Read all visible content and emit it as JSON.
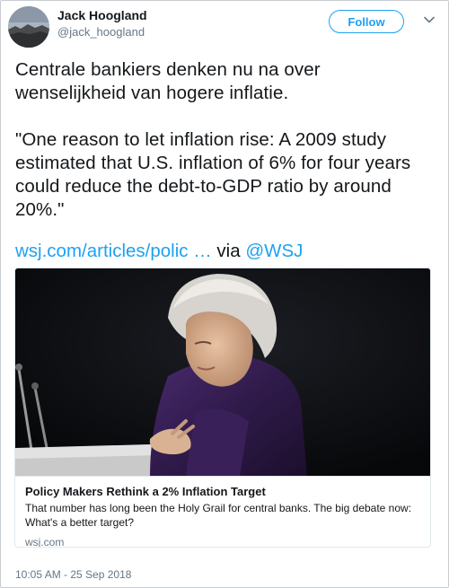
{
  "user": {
    "name": "Jack Hoogland",
    "handle": "@jack_hoogland"
  },
  "follow_label": "Follow",
  "tweet": {
    "text": "Centrale bankiers denken nu na over\nwenselijkheid van hogere inflatie.\n\n\"One reason to let inflation rise: A 2009 study estimated that U.S. inflation of 6% for four years could reduce the debt-to-GDP ratio by around 20%.\"",
    "link_text": "wsj.com/articles/polic",
    "ellipsis": " …",
    "via": " via ",
    "mention": "@WSJ"
  },
  "card": {
    "title": "Policy Makers Rethink a 2% Inflation Target",
    "description": "That number has long been the Holy Grail for central banks. The big debate now: What's a better target?",
    "domain": "wsj.com"
  },
  "timestamp": "10:05 AM - 25 Sep 2018",
  "colors": {
    "accent": "#1da1f2",
    "secondary_text": "#657786",
    "primary_text": "#14171a"
  }
}
